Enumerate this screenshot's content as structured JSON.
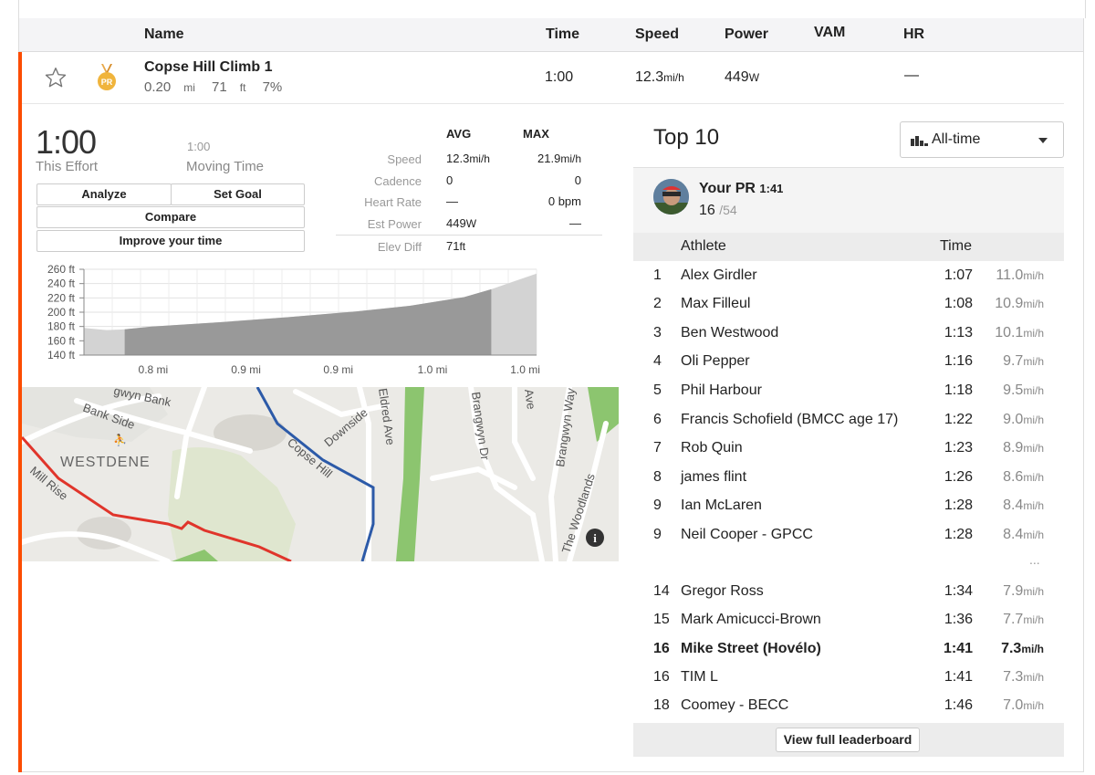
{
  "header": {
    "name": "Name",
    "time": "Time",
    "speed": "Speed",
    "power": "Power",
    "vam": "VAM",
    "hr": "HR"
  },
  "segment": {
    "name": "Copse Hill Climb 1",
    "distance": "0.20",
    "distance_unit": "mi",
    "elevation": "71",
    "elevation_unit": "ft",
    "grade": "7%",
    "time": "1:00",
    "speed": "12.3",
    "speed_unit": "mi/h",
    "power": "449",
    "power_unit": "W",
    "hr": "—",
    "badge": "PR"
  },
  "effort": {
    "time": "1:00",
    "time_label": "This Effort",
    "moving_time": "1:00",
    "moving_label": "Moving Time",
    "buttons": {
      "analyze": "Analyze",
      "set_goal": "Set Goal",
      "compare": "Compare",
      "improve": "Improve your time"
    }
  },
  "stats": {
    "avg_header": "AVG",
    "max_header": "MAX",
    "rows": [
      {
        "label": "Speed",
        "avg": "12.3",
        "avg_unit": "mi/h",
        "max": "21.9",
        "max_unit": "mi/h"
      },
      {
        "label": "Cadence",
        "avg": "0",
        "avg_unit": "",
        "max": "0",
        "max_unit": ""
      },
      {
        "label": "Heart Rate",
        "avg": "—",
        "avg_unit": "",
        "max": "0 bpm",
        "max_unit": ""
      },
      {
        "label": "Est Power",
        "avg": "449",
        "avg_unit": "W",
        "max": "—",
        "max_unit": ""
      },
      {
        "label": "Elev Diff",
        "avg": "71",
        "avg_unit": "ft",
        "max": "",
        "max_unit": ""
      }
    ]
  },
  "chart_data": {
    "type": "area",
    "y_ticks": [
      "260 ft",
      "240 ft",
      "220 ft",
      "200 ft",
      "180 ft",
      "160 ft",
      "140 ft"
    ],
    "x_ticks": [
      "0.8 mi",
      "0.9 mi",
      "0.9 mi",
      "1.0 mi",
      "1.0 mi"
    ],
    "ylim": [
      140,
      260
    ],
    "profile_ft": [
      [
        0,
        178
      ],
      [
        0.05,
        175
      ],
      [
        0.09,
        176
      ],
      [
        0.15,
        180
      ],
      [
        0.3,
        186
      ],
      [
        0.45,
        193
      ],
      [
        0.6,
        201
      ],
      [
        0.72,
        209
      ],
      [
        0.84,
        221
      ],
      [
        0.9,
        232
      ],
      [
        0.95,
        243
      ],
      [
        1.0,
        254
      ]
    ],
    "highlight_range": [
      0.09,
      0.9
    ]
  },
  "map": {
    "labels": [
      "Bank Side",
      "WESTDENE",
      "Mill Rise",
      "Copse Hill",
      "Downside",
      "Eldred Ave",
      "Brangwyn Dr",
      "Brangwyn Way",
      "The Woodlands",
      "gwyn Bank",
      "Ave"
    ],
    "info_icon": "i"
  },
  "leaderboard": {
    "title": "Top 10",
    "filter": "All-time",
    "your_pr_label": "Your PR",
    "your_pr_time": "1:41",
    "your_rank": "16",
    "your_total": "/54",
    "col_athlete": "Athlete",
    "col_time": "Time",
    "rows": [
      {
        "rank": "1",
        "name": "Alex Girdler",
        "time": "1:07",
        "speed": "11.0",
        "unit": "mi/h"
      },
      {
        "rank": "2",
        "name": "Max Filleul",
        "time": "1:08",
        "speed": "10.9",
        "unit": "mi/h"
      },
      {
        "rank": "3",
        "name": "Ben Westwood",
        "time": "1:13",
        "speed": "10.1",
        "unit": "mi/h"
      },
      {
        "rank": "4",
        "name": "Oli Pepper",
        "time": "1:16",
        "speed": "9.7",
        "unit": "mi/h"
      },
      {
        "rank": "5",
        "name": "Phil Harbour",
        "time": "1:18",
        "speed": "9.5",
        "unit": "mi/h"
      },
      {
        "rank": "6",
        "name": "Francis Schofield (BMCC age 17)",
        "time": "1:22",
        "speed": "9.0",
        "unit": "mi/h"
      },
      {
        "rank": "7",
        "name": "Rob Quin",
        "time": "1:23",
        "speed": "8.9",
        "unit": "mi/h"
      },
      {
        "rank": "8",
        "name": "james flint",
        "time": "1:26",
        "speed": "8.6",
        "unit": "mi/h"
      },
      {
        "rank": "9",
        "name": "Ian McLaren",
        "time": "1:28",
        "speed": "8.4",
        "unit": "mi/h"
      },
      {
        "rank": "9",
        "name": "Neil Cooper - GPCC",
        "time": "1:28",
        "speed": "8.4",
        "unit": "mi/h"
      }
    ],
    "ellipsis": "...",
    "rows2": [
      {
        "rank": "14",
        "name": "Gregor Ross",
        "time": "1:34",
        "speed": "7.9",
        "unit": "mi/h"
      },
      {
        "rank": "15",
        "name": "Mark Amicucci-Brown",
        "time": "1:36",
        "speed": "7.7",
        "unit": "mi/h"
      },
      {
        "rank": "16",
        "name": "Mike Street (Hovélo)",
        "time": "1:41",
        "speed": "7.3",
        "unit": "mi/h",
        "me": true
      },
      {
        "rank": "16",
        "name": "TIM L",
        "time": "1:41",
        "speed": "7.3",
        "unit": "mi/h"
      },
      {
        "rank": "18",
        "name": "Coomey - BECC",
        "time": "1:46",
        "speed": "7.0",
        "unit": "mi/h"
      }
    ],
    "view_full": "View full leaderboard"
  }
}
